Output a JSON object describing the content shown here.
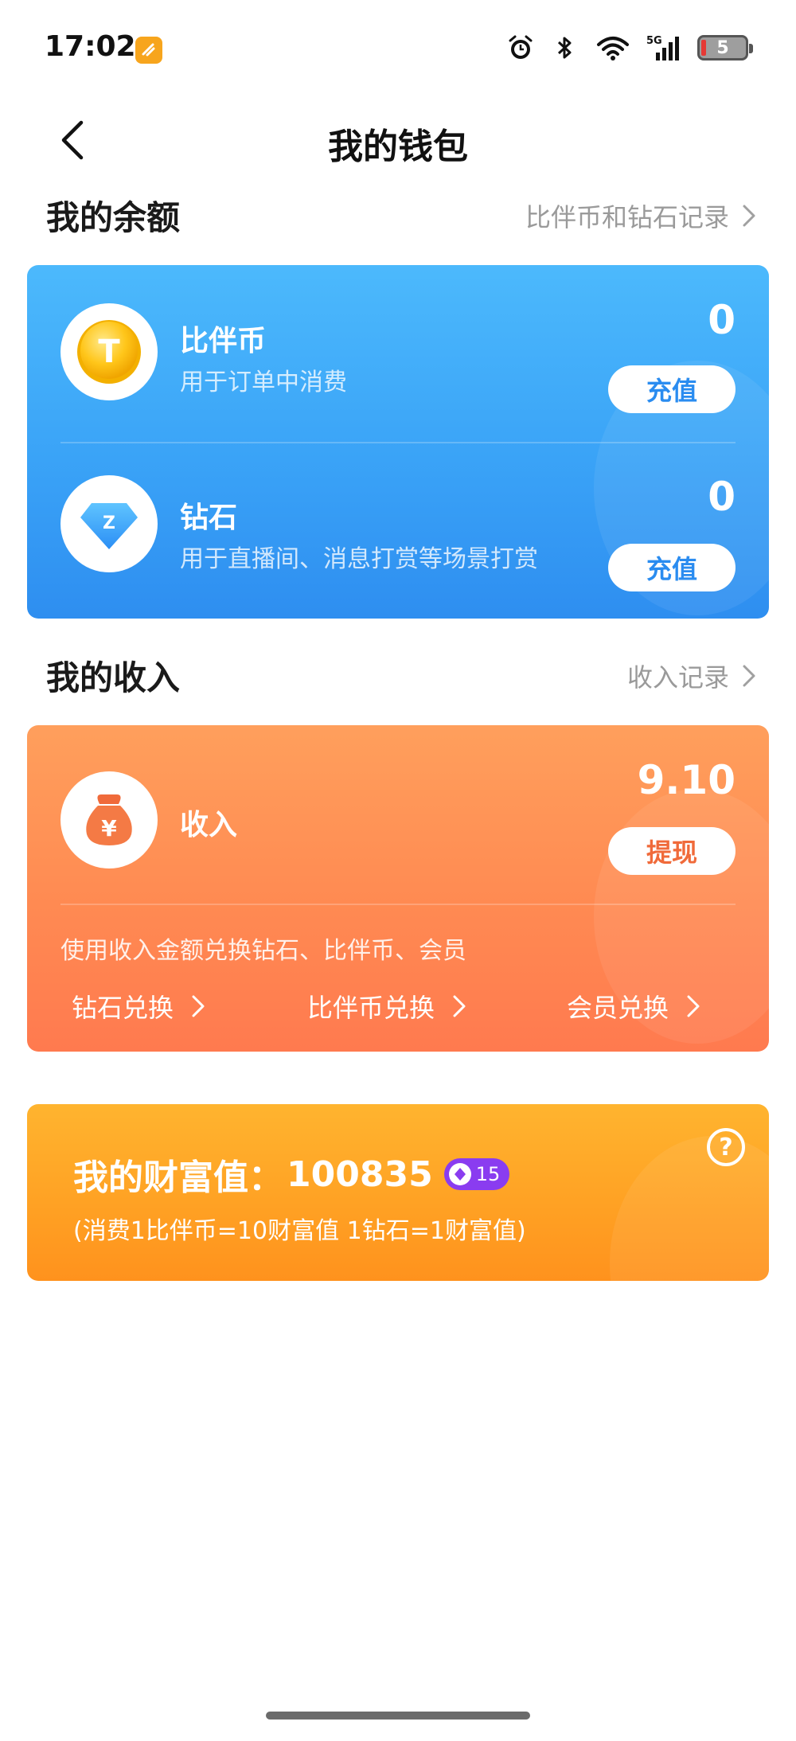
{
  "status_bar": {
    "time": "17:02",
    "signal_label": "5G",
    "battery_level": "5"
  },
  "nav": {
    "title": "我的钱包"
  },
  "balance": {
    "title": "我的余额",
    "link": "比伴币和钻石记录",
    "items": [
      {
        "name": "比伴币",
        "desc": "用于订单中消费",
        "amount": "0",
        "button": "充值",
        "icon": "coin-icon",
        "icon_glyph": "T"
      },
      {
        "name": "钻石",
        "desc": "用于直播间、消息打赏等场景打赏",
        "amount": "0",
        "button": "充值",
        "icon": "diamond-icon",
        "icon_glyph": "Z"
      }
    ]
  },
  "income": {
    "title": "我的收入",
    "link": "收入记录",
    "name": "收入",
    "amount": "9.10",
    "button": "提现",
    "icon_glyph": "¥",
    "hint": "使用收入金额兑换钻石、比伴币、会员",
    "exchanges": [
      "钻石兑换",
      "比伴币兑换",
      "会员兑换"
    ]
  },
  "wealth": {
    "label": "我的财富值：",
    "value": "100835",
    "level": "15",
    "note": "(消费1比伴币=10财富值 1钻石=1财富值)",
    "help": "?"
  },
  "colors": {
    "blue_card": "#3aa3f7",
    "orange_card": "#ff8a52",
    "gold_card": "#ffa224",
    "level_badge": "#8a3cf0"
  }
}
